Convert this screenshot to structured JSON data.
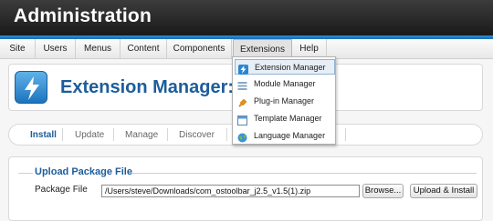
{
  "app": {
    "title": "Administration"
  },
  "menubar": {
    "items": [
      {
        "label": "Site"
      },
      {
        "label": "Users"
      },
      {
        "label": "Menus"
      },
      {
        "label": "Content"
      },
      {
        "label": "Components"
      },
      {
        "label": "Extensions"
      },
      {
        "label": "Help"
      }
    ]
  },
  "dropdown": {
    "items": [
      {
        "label": "Extension Manager",
        "icon": "extension-icon"
      },
      {
        "label": "Module Manager",
        "icon": "module-icon"
      },
      {
        "label": "Plug-in Manager",
        "icon": "plugin-icon"
      },
      {
        "label": "Template Manager",
        "icon": "template-icon"
      },
      {
        "label": "Language Manager",
        "icon": "language-icon"
      }
    ]
  },
  "page": {
    "title": "Extension Manager: Ins"
  },
  "tabs": [
    {
      "label": "Install"
    },
    {
      "label": "Update"
    },
    {
      "label": "Manage"
    },
    {
      "label": "Discover"
    }
  ],
  "upload": {
    "legend": "Upload Package File",
    "package_label": "Package File",
    "file_value": "/Users/steve/Downloads/com_ostoolbar_j2.5_v1.5(1).zip",
    "browse_label": "Browse...",
    "upload_label": "Upload & Install"
  },
  "colors": {
    "accent": "#1c5d9b",
    "topbar": "#2a2a2a",
    "stripe": "#2c8fd8"
  }
}
